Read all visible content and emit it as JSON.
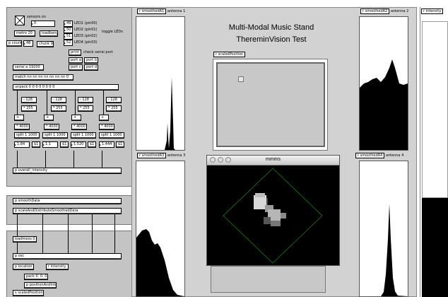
{
  "left_panel": {
    "sensors_label": "sensors on",
    "sensors_num": "0",
    "metro": "metro 20",
    "loadbang": "loadbang",
    "leds": [
      {
        "num": "49",
        "label": "LED1 (pin00)"
      },
      {
        "num": "50",
        "label": "LED2 (pin01)"
      },
      {
        "num": "51",
        "label": "LED3 (pin02)"
      },
      {
        "num": "52",
        "label": "LED4 (pin03)"
      }
    ],
    "toggle_leds": "toggle LEDs",
    "count": "p count",
    "count_num": "48",
    "chunk": "chunk 9",
    "print": "print",
    "check_serial": "check serial port",
    "port_a": "port a",
    "port_b": "port b",
    "port_c": "port c",
    "port_d": "port d",
    "serial": "serial a 19200",
    "match": "match nn nn nn nn nn nn nn 0",
    "unpack": "unpack 0 0 0 0 0 0 0 0",
    "minus": [
      "- 128",
      "- 128",
      "- 128",
      "- 128"
    ],
    "mult": [
      "* 255",
      "* 255",
      "* 255",
      "* 255"
    ],
    "plus": [
      "+",
      "+",
      "+",
      "+"
    ],
    "min": [
      "* 4000",
      "* 4000",
      "* 4000",
      "* 4000"
    ],
    "split": [
      "split 1 1000",
      "split 1 1000",
      "split 1 1000",
      "split 1 1000"
    ],
    "vals": [
      "1.84",
      "1.1",
      "1.520",
      "1.444"
    ],
    "t1": [
      "$1",
      "$1",
      "$1",
      "$1"
    ],
    "overall": "p overall_intensity",
    "smooth": "p smoothData",
    "scale": "p scaleAndDistributeSmoothedData",
    "loadmess": "loadmess 0",
    "osc": "p osc",
    "location": "p location",
    "r_intensity": "r intensity",
    "pack": "pack 0. 0. 0.",
    "posint": "p positionAndIntensity",
    "scaledpos": "s scaledPosition"
  },
  "graphs": {
    "a1_recv": "r smoothedA1",
    "a1_label": "antenna 1",
    "a2_recv": "r smoothedA2",
    "a2_label": "antenna 2",
    "a3_recv": "r smoothedA3",
    "a3_label": "antenna 3",
    "a4_recv": "r smoothedA4",
    "a4_label": "antenna 4",
    "intensity_recv": "r intensity"
  },
  "center": {
    "title_line1": "Multi-Modal Music Stand",
    "title_line2": "ThereminVision Test",
    "scaled_recv": "r scaledPosition",
    "window_title": "mmms"
  },
  "colors": {
    "patch_bg": "#c4c4c4",
    "panel_bg": "#d2d2d2",
    "window_bg": "#000000",
    "diamond": "#1f7a1f"
  }
}
